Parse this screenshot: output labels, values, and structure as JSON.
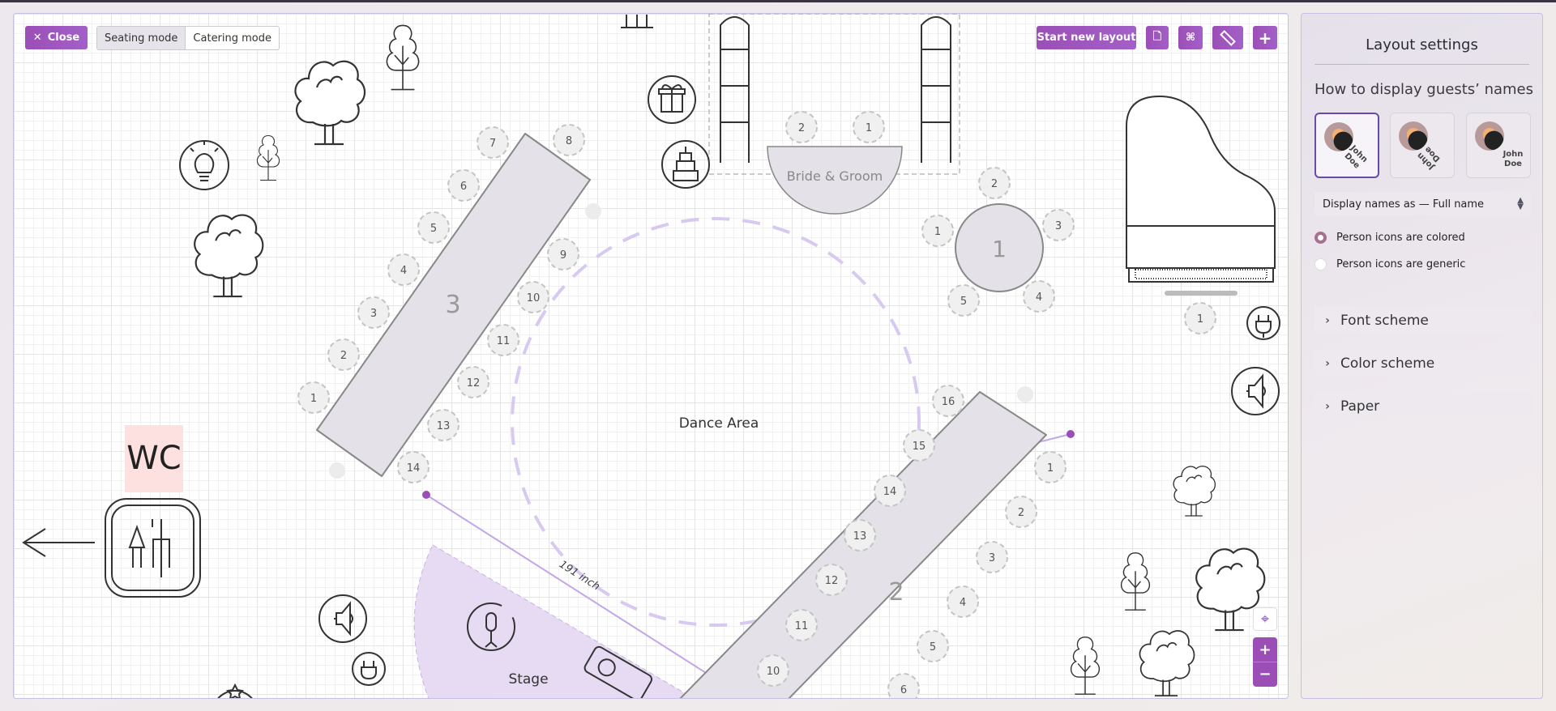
{
  "toolbar": {
    "close_label": "Close",
    "modes": [
      "Seating mode",
      "Catering mode"
    ],
    "active_mode": "Seating mode",
    "start_new_layout": "Start new layout",
    "icons": [
      "file-icon",
      "command-icon",
      "ruler-icon",
      "plus-icon"
    ]
  },
  "canvas": {
    "dance_area_label": "Dance Area",
    "stage_label": "Stage",
    "bride_groom_label": "Bride & Groom",
    "wc_label": "WC",
    "measurement_label": "191 inch",
    "table_3": {
      "label": "3",
      "seats": [
        "1",
        "2",
        "3",
        "4",
        "5",
        "6",
        "7",
        "8",
        "9",
        "10",
        "11",
        "12",
        "13",
        "14"
      ]
    },
    "table_2": {
      "label": "2",
      "seats": [
        "16",
        "15",
        "14",
        "13",
        "12",
        "11",
        "10",
        "1",
        "2",
        "3",
        "4",
        "5",
        "6"
      ]
    },
    "table_1": {
      "label": "1",
      "seats": [
        "1",
        "2",
        "3",
        "4",
        "5"
      ]
    },
    "bride_groom_seats": [
      "2",
      "1"
    ],
    "piano_seat": "1",
    "accent_color": "#9b4fb6",
    "stage_color": "#e4d8f2"
  },
  "panel": {
    "title": "Layout settings",
    "subtitle": "How to display guests’ names",
    "name_styles": [
      {
        "name": "John Doe",
        "selected": true
      },
      {
        "name": "John Doe",
        "selected": false
      },
      {
        "name": "John Doe",
        "selected": false
      }
    ],
    "display_names_select": "Display names as — Full name",
    "radios": [
      {
        "label": "Person icons are colored",
        "checked": true
      },
      {
        "label": "Person icons are generic",
        "checked": false
      }
    ],
    "accordions": [
      "Font scheme",
      "Color scheme",
      "Paper"
    ]
  },
  "zoom": {
    "zoom_in": "+",
    "zoom_out": "−"
  }
}
